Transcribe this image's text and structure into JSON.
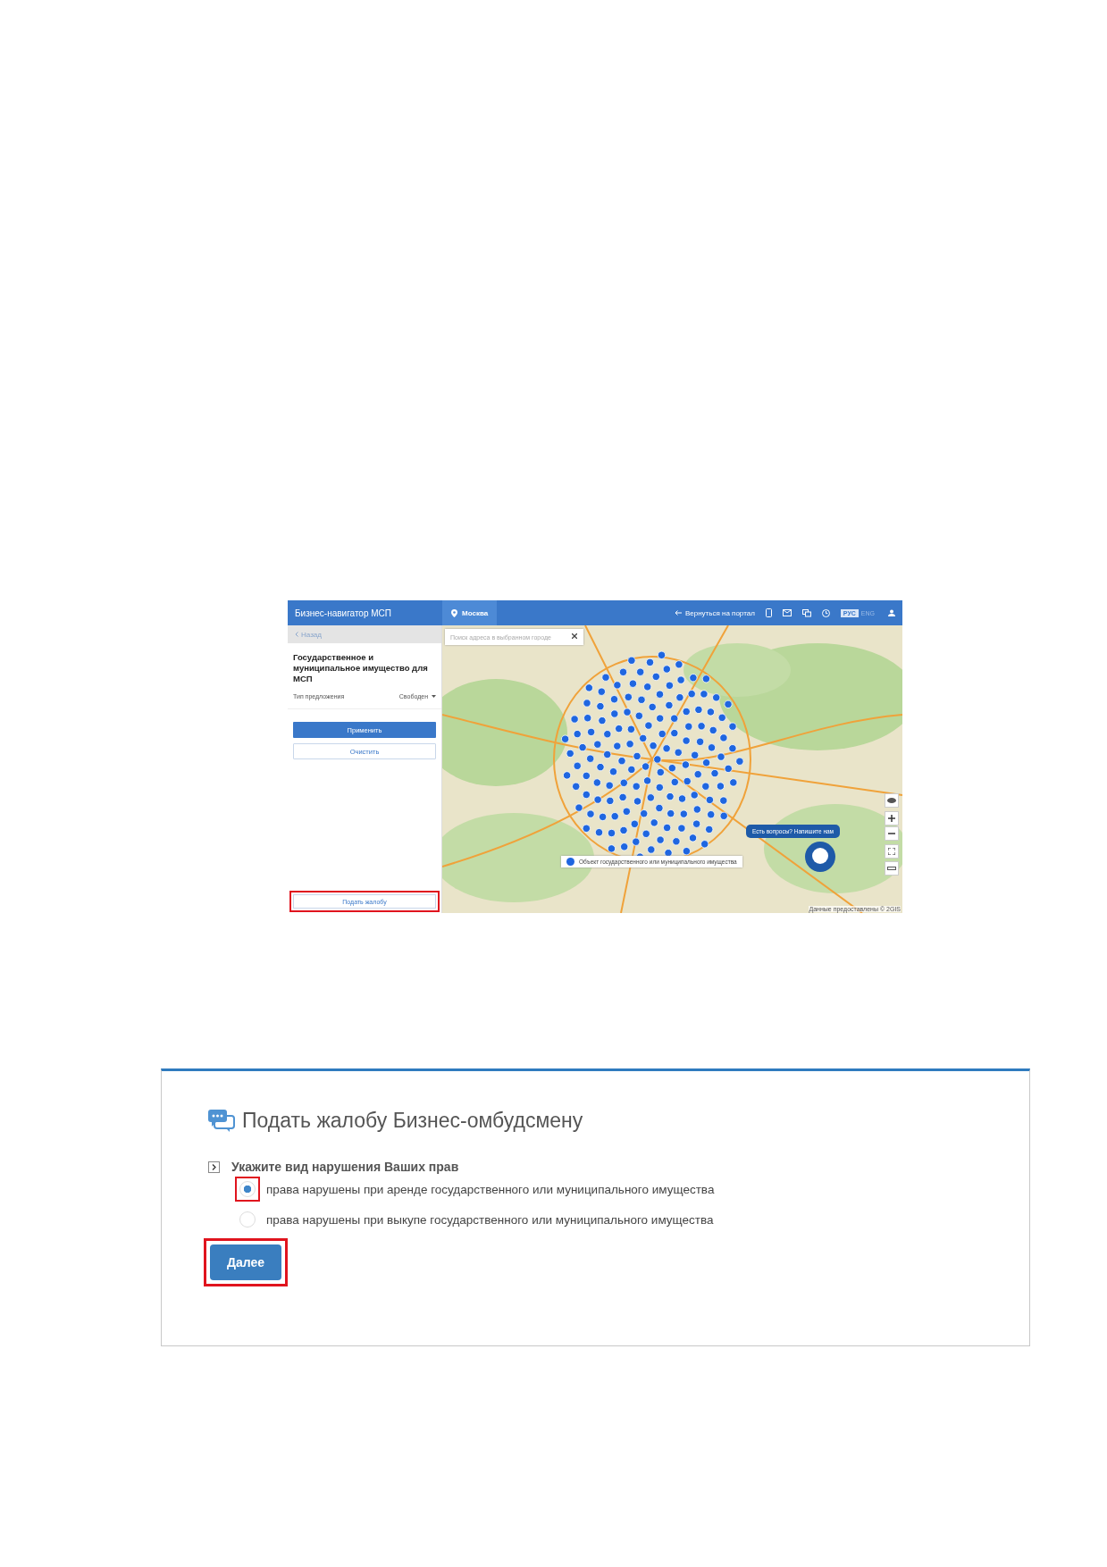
{
  "map_app": {
    "header": {
      "title": "Бизнес-навигатор МСП",
      "city": "Москва",
      "back_link": "Вернуться на портал",
      "languages": [
        {
          "label": "РУС",
          "selected": true
        },
        {
          "label": "ENG",
          "selected": false
        }
      ]
    },
    "sidebar": {
      "back": "Назад",
      "heading": "Государственное и муниципальное имущество для МСП",
      "filter": {
        "label": "Тип предложения",
        "value": "Свободен"
      },
      "buttons": [
        {
          "label": "Применить",
          "kind": "primary"
        },
        {
          "label": "Очистить",
          "kind": "secondary"
        }
      ],
      "complaint_button": {
        "label": "Подать жалобу",
        "highlighted": true
      }
    },
    "map": {
      "search": {
        "placeholder": "Поиск адреса в выбранном городе"
      },
      "legend": "Объект государственного или муниципального имущества",
      "chat_prompt": "Есть вопросы? Напишите нам",
      "attribution": "Данные предоставлены © 2GIS"
    }
  },
  "complaint_form": {
    "title": "Подать жалобу Бизнес-омбудсмену",
    "question": "Укажите вид нарушения Ваших прав",
    "options": [
      {
        "label": "права нарушены при аренде государственного или муниципального имущества",
        "selected": true,
        "highlighted": true
      },
      {
        "label": "права нарушены при выкупе государственного или муниципального имущества",
        "selected": false,
        "highlighted": false
      }
    ],
    "next_button": {
      "label": "Далее",
      "highlighted": true
    }
  }
}
